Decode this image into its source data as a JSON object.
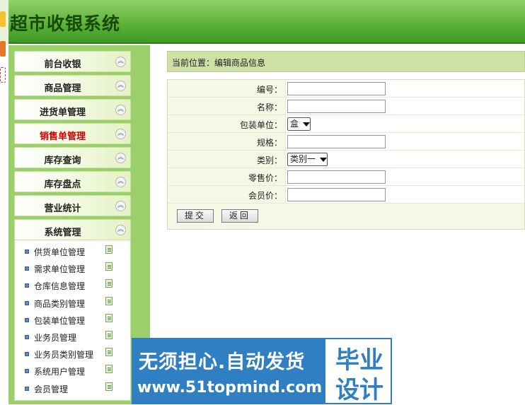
{
  "app": {
    "title": "超市收银系统"
  },
  "sidebar": {
    "menus": [
      {
        "label": "前台收银",
        "active": false
      },
      {
        "label": "商品管理",
        "active": false
      },
      {
        "label": "进货单管理",
        "active": false
      },
      {
        "label": "销售单管理",
        "active": true
      },
      {
        "label": "库存查询",
        "active": false
      },
      {
        "label": "库存盘点",
        "active": false
      },
      {
        "label": "营业统计",
        "active": false
      },
      {
        "label": "系统管理",
        "active": false
      }
    ],
    "submenu": [
      "供货单位管理",
      "需求单位管理",
      "仓库信息管理",
      "商品类别管理",
      "包装单位管理",
      "业务员管理",
      "业务员类别管理",
      "系统用户管理",
      "会员管理"
    ]
  },
  "breadcrumb": "当前位置：编辑商品信息",
  "form": {
    "fields": [
      {
        "label": "编号：",
        "type": "text",
        "value": ""
      },
      {
        "label": "名称：",
        "type": "text",
        "value": ""
      },
      {
        "label": "包装单位：",
        "type": "select",
        "value": "盒"
      },
      {
        "label": "规格：",
        "type": "text",
        "value": ""
      },
      {
        "label": "类别：",
        "type": "select",
        "value": "类别一"
      },
      {
        "label": "零售价：",
        "type": "text",
        "value": ""
      },
      {
        "label": "会员价：",
        "type": "text",
        "value": ""
      }
    ],
    "submit_label": "提交",
    "back_label": "返回"
  },
  "watermark": {
    "line1": "无须担心.自动发货",
    "line2": "www.51topmind.com",
    "box_line1": "毕业",
    "box_line2": "设计"
  },
  "colors": {
    "header": "#5fb23a",
    "sidebar_bg": "#9bcf6c",
    "active_menu": "#d40000",
    "breadcrumb_bg": "#cfe0a6",
    "watermark": "#2f7fc2"
  }
}
